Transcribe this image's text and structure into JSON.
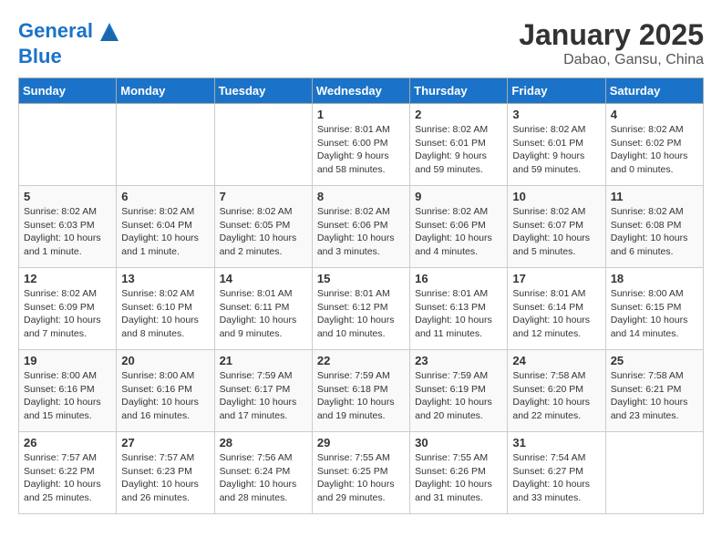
{
  "header": {
    "logo_line1": "General",
    "logo_line2": "Blue",
    "month_title": "January 2025",
    "subtitle": "Dabao, Gansu, China"
  },
  "days_of_week": [
    "Sunday",
    "Monday",
    "Tuesday",
    "Wednesday",
    "Thursday",
    "Friday",
    "Saturday"
  ],
  "weeks": [
    [
      {
        "day": "",
        "content": ""
      },
      {
        "day": "",
        "content": ""
      },
      {
        "day": "",
        "content": ""
      },
      {
        "day": "1",
        "content": "Sunrise: 8:01 AM\nSunset: 6:00 PM\nDaylight: 9 hours\nand 58 minutes."
      },
      {
        "day": "2",
        "content": "Sunrise: 8:02 AM\nSunset: 6:01 PM\nDaylight: 9 hours\nand 59 minutes."
      },
      {
        "day": "3",
        "content": "Sunrise: 8:02 AM\nSunset: 6:01 PM\nDaylight: 9 hours\nand 59 minutes."
      },
      {
        "day": "4",
        "content": "Sunrise: 8:02 AM\nSunset: 6:02 PM\nDaylight: 10 hours\nand 0 minutes."
      }
    ],
    [
      {
        "day": "5",
        "content": "Sunrise: 8:02 AM\nSunset: 6:03 PM\nDaylight: 10 hours\nand 1 minute."
      },
      {
        "day": "6",
        "content": "Sunrise: 8:02 AM\nSunset: 6:04 PM\nDaylight: 10 hours\nand 1 minute."
      },
      {
        "day": "7",
        "content": "Sunrise: 8:02 AM\nSunset: 6:05 PM\nDaylight: 10 hours\nand 2 minutes."
      },
      {
        "day": "8",
        "content": "Sunrise: 8:02 AM\nSunset: 6:06 PM\nDaylight: 10 hours\nand 3 minutes."
      },
      {
        "day": "9",
        "content": "Sunrise: 8:02 AM\nSunset: 6:06 PM\nDaylight: 10 hours\nand 4 minutes."
      },
      {
        "day": "10",
        "content": "Sunrise: 8:02 AM\nSunset: 6:07 PM\nDaylight: 10 hours\nand 5 minutes."
      },
      {
        "day": "11",
        "content": "Sunrise: 8:02 AM\nSunset: 6:08 PM\nDaylight: 10 hours\nand 6 minutes."
      }
    ],
    [
      {
        "day": "12",
        "content": "Sunrise: 8:02 AM\nSunset: 6:09 PM\nDaylight: 10 hours\nand 7 minutes."
      },
      {
        "day": "13",
        "content": "Sunrise: 8:02 AM\nSunset: 6:10 PM\nDaylight: 10 hours\nand 8 minutes."
      },
      {
        "day": "14",
        "content": "Sunrise: 8:01 AM\nSunset: 6:11 PM\nDaylight: 10 hours\nand 9 minutes."
      },
      {
        "day": "15",
        "content": "Sunrise: 8:01 AM\nSunset: 6:12 PM\nDaylight: 10 hours\nand 10 minutes."
      },
      {
        "day": "16",
        "content": "Sunrise: 8:01 AM\nSunset: 6:13 PM\nDaylight: 10 hours\nand 11 minutes."
      },
      {
        "day": "17",
        "content": "Sunrise: 8:01 AM\nSunset: 6:14 PM\nDaylight: 10 hours\nand 12 minutes."
      },
      {
        "day": "18",
        "content": "Sunrise: 8:00 AM\nSunset: 6:15 PM\nDaylight: 10 hours\nand 14 minutes."
      }
    ],
    [
      {
        "day": "19",
        "content": "Sunrise: 8:00 AM\nSunset: 6:16 PM\nDaylight: 10 hours\nand 15 minutes."
      },
      {
        "day": "20",
        "content": "Sunrise: 8:00 AM\nSunset: 6:16 PM\nDaylight: 10 hours\nand 16 minutes."
      },
      {
        "day": "21",
        "content": "Sunrise: 7:59 AM\nSunset: 6:17 PM\nDaylight: 10 hours\nand 17 minutes."
      },
      {
        "day": "22",
        "content": "Sunrise: 7:59 AM\nSunset: 6:18 PM\nDaylight: 10 hours\nand 19 minutes."
      },
      {
        "day": "23",
        "content": "Sunrise: 7:59 AM\nSunset: 6:19 PM\nDaylight: 10 hours\nand 20 minutes."
      },
      {
        "day": "24",
        "content": "Sunrise: 7:58 AM\nSunset: 6:20 PM\nDaylight: 10 hours\nand 22 minutes."
      },
      {
        "day": "25",
        "content": "Sunrise: 7:58 AM\nSunset: 6:21 PM\nDaylight: 10 hours\nand 23 minutes."
      }
    ],
    [
      {
        "day": "26",
        "content": "Sunrise: 7:57 AM\nSunset: 6:22 PM\nDaylight: 10 hours\nand 25 minutes."
      },
      {
        "day": "27",
        "content": "Sunrise: 7:57 AM\nSunset: 6:23 PM\nDaylight: 10 hours\nand 26 minutes."
      },
      {
        "day": "28",
        "content": "Sunrise: 7:56 AM\nSunset: 6:24 PM\nDaylight: 10 hours\nand 28 minutes."
      },
      {
        "day": "29",
        "content": "Sunrise: 7:55 AM\nSunset: 6:25 PM\nDaylight: 10 hours\nand 29 minutes."
      },
      {
        "day": "30",
        "content": "Sunrise: 7:55 AM\nSunset: 6:26 PM\nDaylight: 10 hours\nand 31 minutes."
      },
      {
        "day": "31",
        "content": "Sunrise: 7:54 AM\nSunset: 6:27 PM\nDaylight: 10 hours\nand 33 minutes."
      },
      {
        "day": "",
        "content": ""
      }
    ]
  ]
}
